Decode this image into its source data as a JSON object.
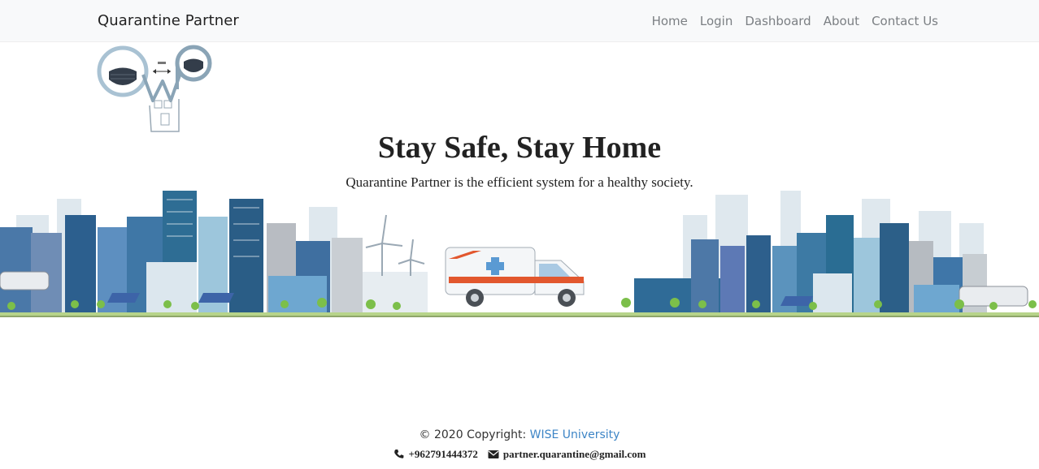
{
  "navbar": {
    "brand": "Quarantine Partner",
    "links": [
      {
        "label": "Home"
      },
      {
        "label": "Login"
      },
      {
        "label": "Dashboard"
      },
      {
        "label": "About"
      },
      {
        "label": "Contact Us"
      }
    ]
  },
  "hero": {
    "title": "Stay Safe, Stay Home",
    "subtitle": "Quarantine Partner is the efficient system for a healthy society."
  },
  "footer": {
    "copyright_prefix": "© 2020 Copyright:",
    "copyright_link": "WISE University",
    "phone": "+962791444372",
    "email": "partner.quarantine@gmail.com"
  },
  "icons": {
    "phone": "phone-icon",
    "email": "envelope-icon"
  },
  "colors": {
    "navbar_bg": "#f8f9fa",
    "link_blue": "#3d85c6",
    "nav_text": "#7b7f83"
  }
}
